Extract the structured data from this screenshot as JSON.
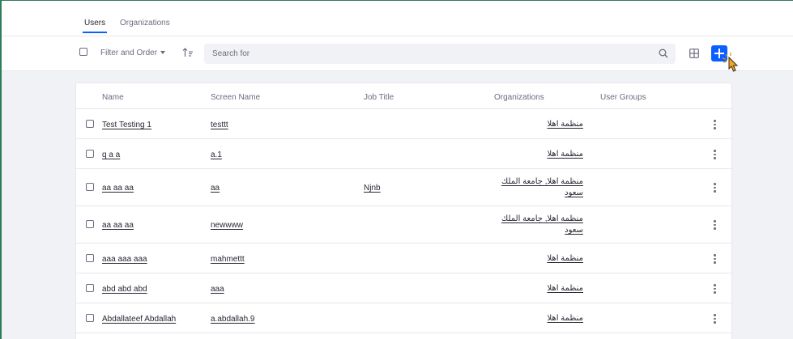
{
  "tabs": [
    {
      "label": "Users",
      "active": true
    },
    {
      "label": "Organizations",
      "active": false
    }
  ],
  "toolbar": {
    "filter_label": "Filter and Order",
    "search_placeholder": "Search for"
  },
  "colors": {
    "accent": "#0b5fff",
    "frame_border": "#2e7d5b",
    "muted_text": "#6b6c7e"
  },
  "icons": [
    "checkbox-icon",
    "chevron-down-icon",
    "sort-order-icon",
    "search-icon",
    "grid-view-icon",
    "plus-icon",
    "cursor-pointer-icon",
    "kebab-menu-icon"
  ],
  "table": {
    "columns": [
      "Name",
      "Screen Name",
      "Job Title",
      "Organizations",
      "User Groups"
    ],
    "rows": [
      {
        "name": "Test Testing 1",
        "screen_name": "testtt",
        "job_title": "",
        "organizations": "منظمة اهلا",
        "user_groups": ""
      },
      {
        "name": "q a a",
        "screen_name": "a.1",
        "job_title": "",
        "organizations": "منظمة اهلا",
        "user_groups": ""
      },
      {
        "name": "aa aa aa",
        "screen_name": "aa",
        "job_title": "Njnb",
        "organizations": "منظمة اهلا, جامعة الملك سعود",
        "user_groups": ""
      },
      {
        "name": "aa aa aa",
        "screen_name": "newwww",
        "job_title": "",
        "organizations": "منظمة اهلا, جامعة الملك سعود",
        "user_groups": ""
      },
      {
        "name": "aaa aaa aaa",
        "screen_name": "mahmettt",
        "job_title": "",
        "organizations": "منظمة اهلا",
        "user_groups": ""
      },
      {
        "name": "abd abd abd",
        "screen_name": "aaa",
        "job_title": "",
        "organizations": "منظمة اهلا",
        "user_groups": ""
      },
      {
        "name": "Abdallateef Abdallah",
        "screen_name": "a.abdallah.9",
        "job_title": "",
        "organizations": "منظمة اهلا",
        "user_groups": ""
      }
    ]
  }
}
